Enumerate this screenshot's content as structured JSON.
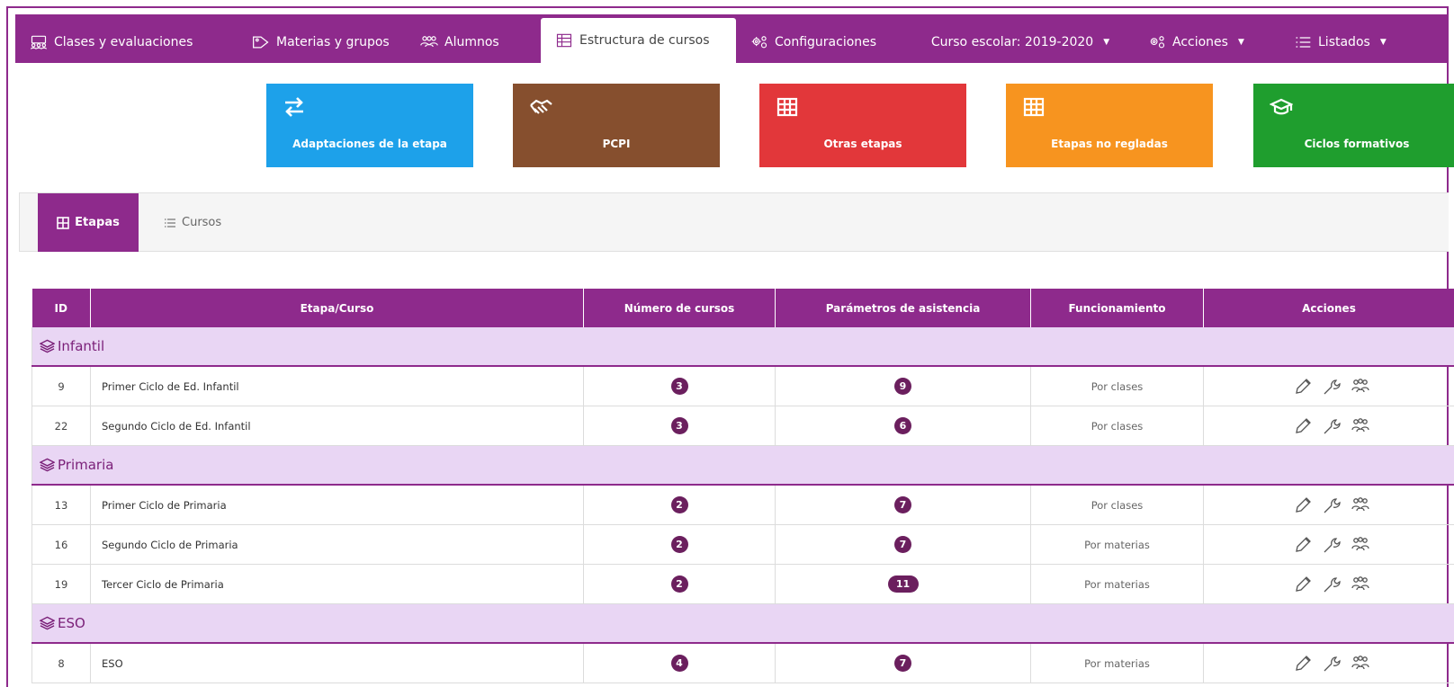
{
  "nav": {
    "items": [
      {
        "label": "Clases y evaluaciones",
        "icon": "people-group-icon"
      },
      {
        "label": "Materias y grupos",
        "icon": "tag-icon"
      },
      {
        "label": "Alumnos",
        "icon": "users-icon"
      },
      {
        "label": "Estructura de cursos",
        "icon": "table-icon",
        "active": true
      },
      {
        "label": "Configuraciones",
        "icon": "gears-icon"
      }
    ],
    "school_year": "Curso escolar: 2019-2020",
    "acciones": "Acciones",
    "listados": "Listados"
  },
  "tiles": [
    {
      "label": "Adaptaciones de la etapa",
      "color": "#1da1ea",
      "icon": "swap-arrows-icon"
    },
    {
      "label": "PCPI",
      "color": "#864f2e",
      "icon": "handshake-icon"
    },
    {
      "label": "Otras etapas",
      "color": "#e2373a",
      "icon": "grid-icon"
    },
    {
      "label": "Etapas no regladas",
      "color": "#f7941f",
      "icon": "grid-icon"
    },
    {
      "label": "Ciclos formativos",
      "color": "#1f9e2e",
      "icon": "graduation-cap-icon"
    }
  ],
  "tabs": {
    "etapas": "Etapas",
    "cursos": "Cursos"
  },
  "table": {
    "headers": [
      "ID",
      "Etapa/Curso",
      "Número de cursos",
      "Parámetros de asistencia",
      "Funcionamiento",
      "Acciones"
    ],
    "groups": [
      {
        "name": "Infantil",
        "rows": [
          {
            "id": "9",
            "name": "Primer Ciclo de Ed. Infantil",
            "cursos": "3",
            "asistencia": "9",
            "func": "Por clases"
          },
          {
            "id": "22",
            "name": "Segundo Ciclo de Ed. Infantil",
            "cursos": "3",
            "asistencia": "6",
            "func": "Por clases"
          }
        ]
      },
      {
        "name": "Primaria",
        "rows": [
          {
            "id": "13",
            "name": "Primer Ciclo de Primaria",
            "cursos": "2",
            "asistencia": "7",
            "func": "Por clases"
          },
          {
            "id": "16",
            "name": "Segundo Ciclo de Primaria",
            "cursos": "2",
            "asistencia": "7",
            "func": "Por materias"
          },
          {
            "id": "19",
            "name": "Tercer Ciclo de Primaria",
            "cursos": "2",
            "asistencia": "11",
            "func": "Por materias"
          }
        ]
      },
      {
        "name": "ESO",
        "rows": [
          {
            "id": "8",
            "name": "ESO",
            "cursos": "4",
            "asistencia": "7",
            "func": "Por materias"
          }
        ]
      }
    ]
  },
  "colors": {
    "brand": "#8e2a8c",
    "group_bg": "#e9d6f4",
    "badge": "#6b1f5e"
  }
}
